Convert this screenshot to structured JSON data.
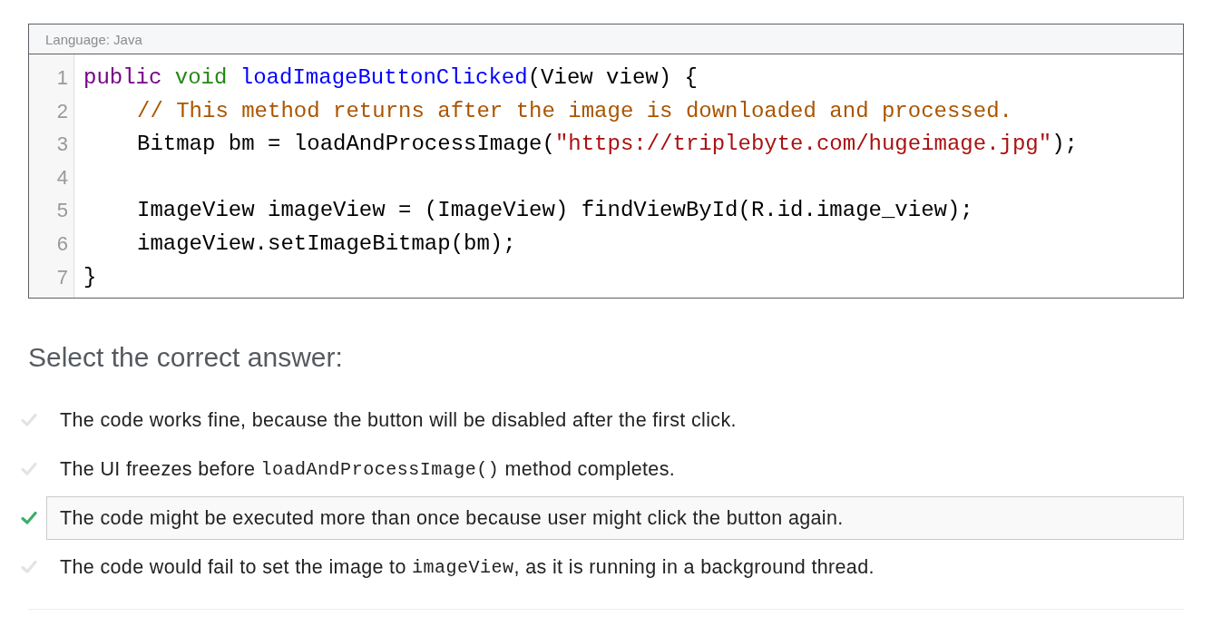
{
  "code_block": {
    "language_label": "Language: Java",
    "lines": [
      {
        "number": "1",
        "tokens": [
          {
            "kind": "keyword",
            "text": "public"
          },
          {
            "kind": "type",
            "text": "void"
          },
          {
            "kind": "def",
            "text": "loadImageButtonClicked"
          },
          {
            "kind": "plain",
            "text": "(View view) {"
          }
        ],
        "children": [
          {
            "number": "2",
            "tokens": [
              {
                "kind": "comment",
                "text": "// This method returns after the image is downloaded and processed."
              }
            ]
          },
          {
            "number": "3",
            "tokens": [
              {
                "kind": "plain",
                "text": "Bitmap bm = loadAndProcessImage("
              },
              {
                "kind": "string",
                "text": "\"https://triplebyte.com/hugeimage.jpg\""
              },
              {
                "kind": "plain",
                "text": ");"
              }
            ]
          },
          {
            "number": "4"
          },
          {
            "number": "5",
            "tokens": [
              {
                "kind": "plain",
                "text": "ImageView imageView = (ImageView) findViewById(R.id.image_view);"
              }
            ]
          },
          {
            "number": "6",
            "tokens": [
              {
                "kind": "plain",
                "text": "imageView.setImageBitmap(bm);"
              }
            ]
          }
        ]
      },
      {
        "number": "7",
        "tokens": [
          {
            "kind": "plain",
            "text": "}"
          }
        ]
      }
    ]
  },
  "question": {
    "prompt": "Select the correct answer:",
    "answers": [
      {
        "selected": false,
        "parts": [
          {
            "kind": "text",
            "text": "The code works fine, because the button will be disabled after the first click."
          }
        ]
      },
      {
        "selected": false,
        "parts": [
          {
            "kind": "text",
            "text": "The UI freezes before "
          },
          {
            "kind": "code",
            "text": "loadAndProcessImage()"
          },
          {
            "kind": "text",
            "text": " method completes."
          }
        ]
      },
      {
        "selected": true,
        "parts": [
          {
            "kind": "text",
            "text": "The code might be executed more than once because user might click the button again."
          }
        ]
      },
      {
        "selected": false,
        "parts": [
          {
            "kind": "text",
            "text": "The code would fail to set the image to "
          },
          {
            "kind": "code",
            "text": "imageView"
          },
          {
            "kind": "text",
            "text": ", as it is running in a background thread."
          }
        ]
      }
    ]
  }
}
